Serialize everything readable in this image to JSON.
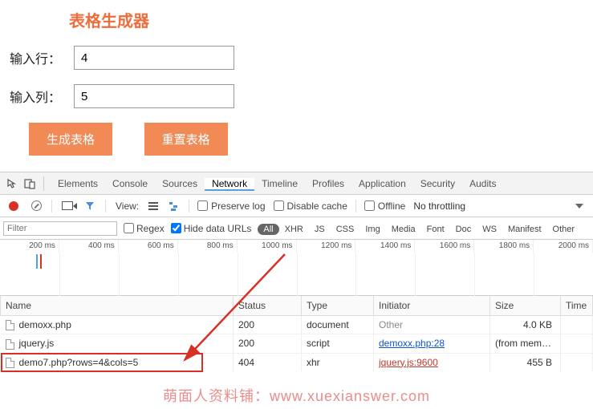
{
  "app": {
    "title": "表格生成器",
    "row_label": "输入行：",
    "col_label": "输入列：",
    "row_value": "4",
    "col_value": "5",
    "btn_generate": "生成表格",
    "btn_reset": "重置表格"
  },
  "devtools": {
    "tabs": [
      "Elements",
      "Console",
      "Sources",
      "Network",
      "Timeline",
      "Profiles",
      "Application",
      "Security",
      "Audits"
    ],
    "active_tab": "Network",
    "toolbar": {
      "view_label": "View:",
      "preserve_log": "Preserve log",
      "disable_cache": "Disable cache",
      "offline": "Offline",
      "throttling": "No throttling"
    },
    "filterbar": {
      "filter_placeholder": "Filter",
      "regex": "Regex",
      "hide_data_urls": "Hide data URLs",
      "types": [
        "All",
        "XHR",
        "JS",
        "CSS",
        "Img",
        "Media",
        "Font",
        "Doc",
        "WS",
        "Manifest",
        "Other"
      ],
      "active_type": "All"
    },
    "timeline_labels": [
      "200 ms",
      "400 ms",
      "600 ms",
      "800 ms",
      "1000 ms",
      "1200 ms",
      "1400 ms",
      "1600 ms",
      "1800 ms",
      "2000 ms"
    ],
    "table": {
      "headers": [
        "Name",
        "Status",
        "Type",
        "Initiator",
        "Size",
        "Time"
      ],
      "rows": [
        {
          "name": "demoxx.php",
          "status": "200",
          "type": "document",
          "initiator": "Other",
          "initiator_link": false,
          "size": "4.0 KB",
          "err": false,
          "muted_initiator": true
        },
        {
          "name": "jquery.js",
          "status": "200",
          "type": "script",
          "initiator": "demoxx.php:28",
          "initiator_link": true,
          "size": "(from memo...",
          "err": false,
          "muted_initiator": false
        },
        {
          "name": "demo7.php?rows=4&cols=5",
          "status": "404",
          "type": "xhr",
          "initiator": "jquery.js:9600",
          "initiator_link": true,
          "size": "455 B",
          "err": true,
          "muted_initiator": false
        }
      ]
    }
  },
  "watermark": "萌面人资料铺：www.xuexianswer.com"
}
